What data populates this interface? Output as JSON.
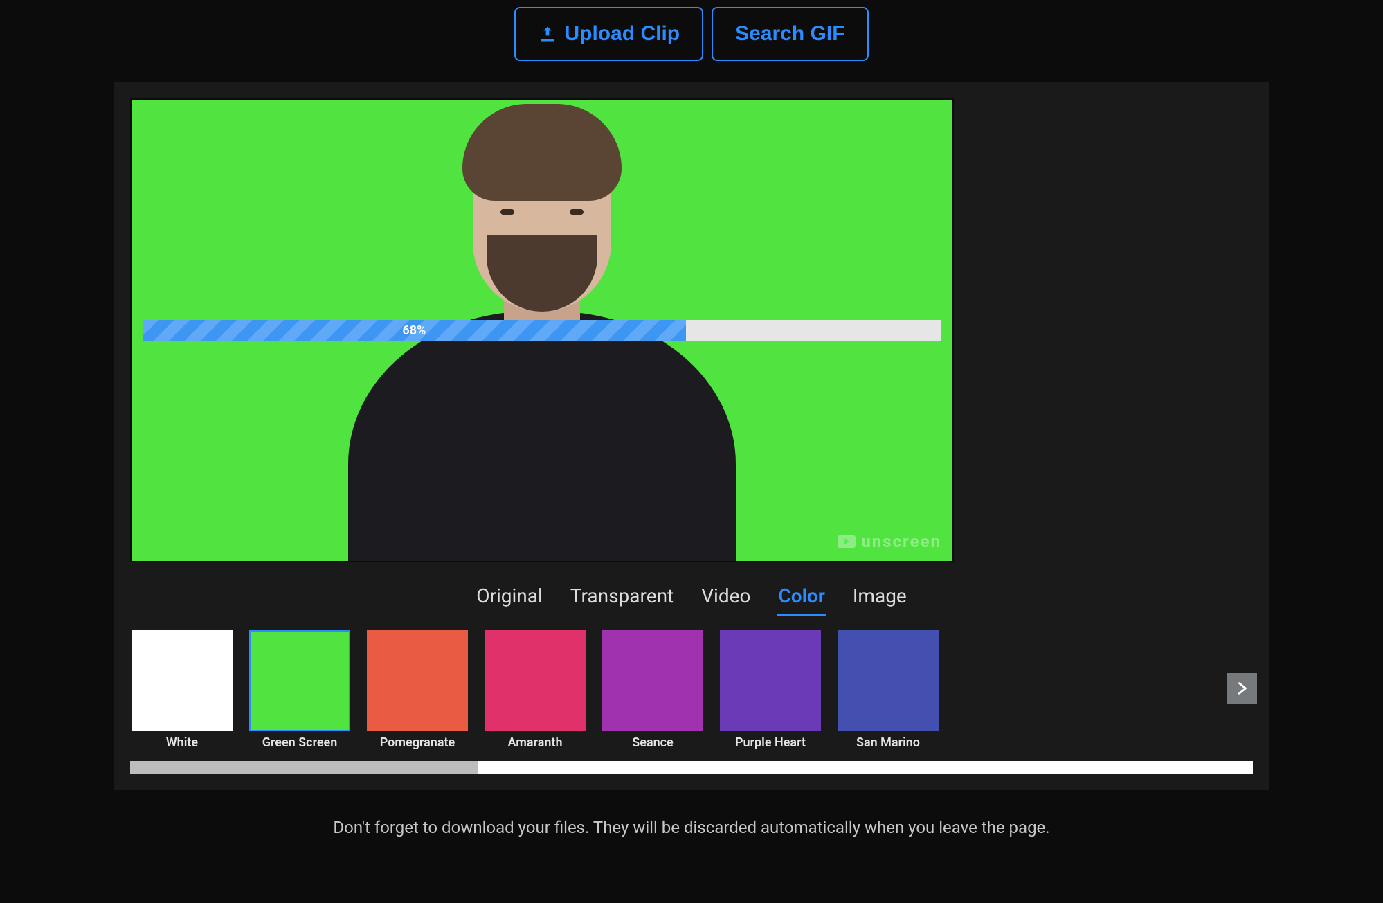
{
  "buttons": {
    "upload": "Upload Clip",
    "search": "Search GIF"
  },
  "progress": {
    "percent": 68,
    "label": "68%"
  },
  "preview": {
    "background_color": "#51e441",
    "watermark": "unscreen"
  },
  "tabs": [
    "Original",
    "Transparent",
    "Video",
    "Color",
    "Image"
  ],
  "active_tab": "Color",
  "swatches": [
    {
      "name": "White",
      "color": "#ffffff",
      "selected": false
    },
    {
      "name": "Green Screen",
      "color": "#51e441",
      "selected": true
    },
    {
      "name": "Pomegranate",
      "color": "#ea5b44",
      "selected": false
    },
    {
      "name": "Amaranth",
      "color": "#e1316b",
      "selected": false
    },
    {
      "name": "Seance",
      "color": "#a032b0",
      "selected": false
    },
    {
      "name": "Purple Heart",
      "color": "#6a3ab7",
      "selected": false
    },
    {
      "name": "San Marino",
      "color": "#4350b0",
      "selected": false
    }
  ],
  "scroll": {
    "thumb_percent": 31
  },
  "footer": "Don't forget to download your files. They will be discarded automatically when you leave the page."
}
